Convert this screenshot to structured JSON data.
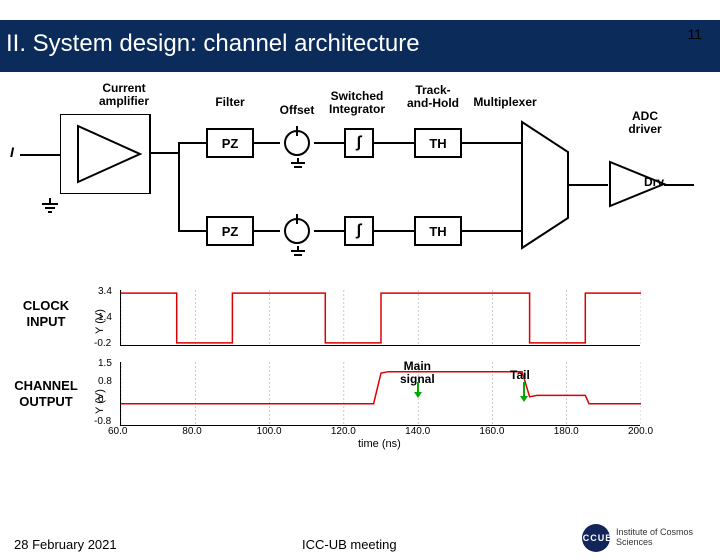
{
  "slide_number": "11",
  "title": "II. System design: channel architecture",
  "labels": {
    "current_amp": "Current\namplifier",
    "filter": "Filter",
    "offset": "Offset",
    "switched_int": "Switched\nIntegrator",
    "track_hold": "Track-\nand-Hold",
    "multiplexer": "Multiplexer",
    "adc_driver": "ADC\ndriver",
    "pz": "PZ",
    "integral": "∫",
    "th": "TH",
    "drv": "Drv",
    "input_i": "I"
  },
  "plot_labels": {
    "clock_input": "CLOCK\nINPUT",
    "channel_output": "CHANNEL\nOUTPUT",
    "main_signal": "Main\nsignal",
    "tail": "Tail",
    "xlabel": "time (ns)",
    "y1label": "Y (V)",
    "y2label": "Y (V)"
  },
  "footer": {
    "date": "28 February 2021",
    "meeting": "ICC-UB meeting",
    "logo_text": "ICCUB",
    "logo_sub": "Institute of Cosmos Sciences"
  },
  "chart_data": [
    {
      "type": "line",
      "title": "CLOCK INPUT",
      "xlabel": "time (ns)",
      "ylabel": "Y (V)",
      "ylim": [
        -0.2,
        3.4
      ],
      "xlim": [
        60,
        200
      ],
      "yticks": [
        -0.2,
        1.4,
        3.4
      ],
      "xticks": [
        60,
        80,
        100,
        120,
        140,
        160,
        180,
        200
      ],
      "series": [
        {
          "name": "clock",
          "color": "#d00",
          "x": [
            60,
            75,
            75,
            90,
            90,
            115,
            115,
            130,
            130,
            170,
            170,
            185,
            185,
            200
          ],
          "y": [
            3.2,
            3.2,
            0.0,
            0.0,
            3.2,
            3.2,
            0.0,
            0.0,
            3.2,
            3.2,
            0.0,
            0.0,
            3.2,
            3.2
          ]
        }
      ]
    },
    {
      "type": "line",
      "title": "CHANNEL OUTPUT",
      "xlabel": "time (ns)",
      "ylabel": "Y (V)",
      "ylim": [
        -0.8,
        1.5
      ],
      "xlim": [
        60,
        200
      ],
      "yticks": [
        -0.8,
        0.0,
        0.8,
        1.5
      ],
      "xticks": [
        60,
        80,
        100,
        120,
        140,
        160,
        180,
        200
      ],
      "annotations": [
        {
          "text": "Main signal",
          "x": 140,
          "y": 1.1
        },
        {
          "text": "Tail",
          "x": 175,
          "y": 0.3
        }
      ],
      "series": [
        {
          "name": "output",
          "color": "#d00",
          "x": [
            60,
            128,
            130,
            132,
            168,
            170,
            172,
            185,
            186,
            200
          ],
          "y": [
            0.0,
            0.0,
            1.1,
            1.15,
            1.15,
            0.25,
            0.3,
            0.3,
            0.0,
            0.0
          ]
        }
      ]
    }
  ]
}
